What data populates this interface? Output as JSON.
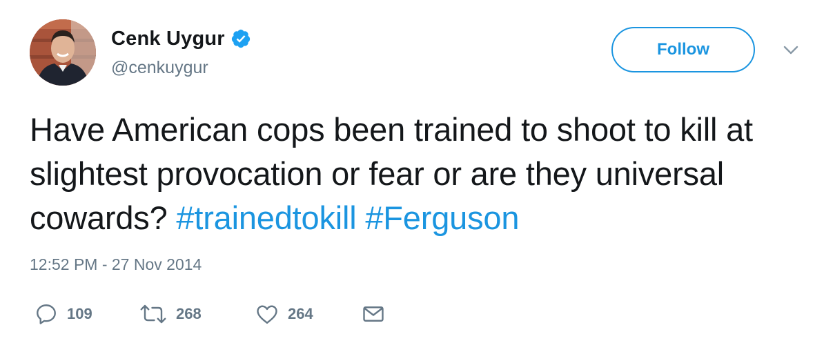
{
  "author": {
    "display_name": "Cenk Uygur",
    "handle": "@cenkuygur",
    "verified": true
  },
  "follow_button": {
    "label": "Follow"
  },
  "tweet": {
    "text_plain": "Have American cops been trained to shoot to kill at slightest provocation or fear or are they universal cowards?",
    "hashtags": [
      "#trainedtokill",
      "#Ferguson"
    ],
    "timestamp": "12:52 PM - 27 Nov 2014"
  },
  "actions": {
    "reply": {
      "icon": "reply-icon",
      "count": "109"
    },
    "retweet": {
      "icon": "retweet-icon",
      "count": "268"
    },
    "like": {
      "icon": "heart-icon",
      "count": "264"
    },
    "message": {
      "icon": "envelope-icon"
    }
  },
  "colors": {
    "link": "#1b95e0",
    "text": "#14171a",
    "secondary": "#657786"
  }
}
